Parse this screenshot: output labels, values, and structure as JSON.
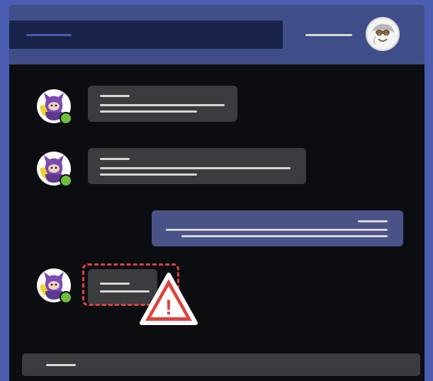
{
  "app": {
    "title": "",
    "accent": "#4a5db0",
    "header_color": "#3f4e88",
    "window_bg": "#0b0d10",
    "bubble_color": "#3b3c3f",
    "own_bubble_color": "#4a5388",
    "status_color": "#6ebd3d",
    "warning_color": "#e0433c"
  },
  "header": {
    "search_placeholder": "",
    "user_name": "",
    "avatar_icon": "user-avatar-icon"
  },
  "messages": [
    {
      "sender": "",
      "text": "",
      "own": false,
      "flagged": false
    },
    {
      "sender": "",
      "text": "",
      "own": false,
      "flagged": false
    },
    {
      "sender": "",
      "text": "",
      "own": true,
      "flagged": false
    },
    {
      "sender": "",
      "text": "",
      "own": false,
      "flagged": true
    }
  ],
  "warning": {
    "icon": "warning-triangle-icon",
    "symbol": "!"
  },
  "composer": {
    "placeholder": ""
  }
}
